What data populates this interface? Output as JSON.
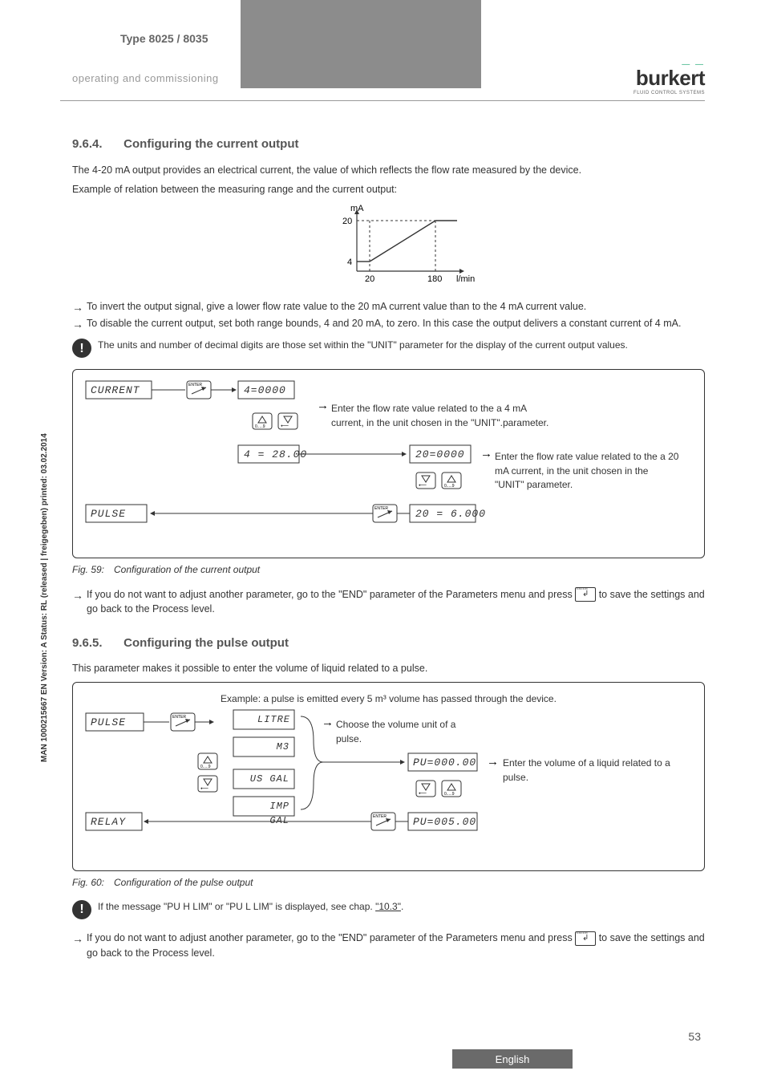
{
  "header": {
    "type_title": "Type 8025 / 8035",
    "subtitle": "operating and commissioning",
    "logo_name": "burkert",
    "logo_tag": "FLUID CONTROL SYSTEMS"
  },
  "sidebar_text": "MAN 1000215667 EN Version: A Status: RL (released | freigegeben) printed: 03.02.2014",
  "section964": {
    "num": "9.6.4.",
    "title": "Configuring the current output",
    "intro1": "The 4-20 mA output provides an electrical current, the value of which reflects the flow rate measured by the device.",
    "intro2": "Example of relation between the measuring range and the current output:",
    "chart": {
      "y_label": "mA",
      "y_ticks": [
        "20",
        "4"
      ],
      "x_ticks": [
        "20",
        "180"
      ],
      "x_label": "l/min"
    },
    "bullet1": "To invert the output signal, give a lower flow rate value to the 20 mA current value than to the 4 mA current value.",
    "bullet2": "To disable the current output, set both range bounds, 4 and 20 mA, to zero. In this case the output delivers a constant current of 4 mA.",
    "notice": "The units and number of decimal digits are those set within the \"UNIT\" parameter for the display of the current output values.",
    "flow": {
      "left_top": "CURRENT",
      "left_bottom": "PULSE",
      "n1": "4=0000",
      "n1b": "4 = 28.00",
      "hint1": "Enter the flow rate value related to the a 4 mA current, in the unit chosen in the \"UNIT\".parameter.",
      "n2": "20=0000",
      "n2b": "20 = 6.000",
      "hint2": "Enter the flow rate value related to the a 20 mA current, in the unit chosen in the \"UNIT\" parameter."
    },
    "fig_caption": "Fig. 59: Configuration of the current output",
    "after": "If you do not want to adjust another parameter, go to the \"END\" parameter of the Parameters menu and press ",
    "after2": " to save the settings and go back to the Process level."
  },
  "section965": {
    "num": "9.6.5.",
    "title": "Configuring the pulse output",
    "intro": "This parameter makes it possible to enter the volume of liquid related to a pulse.",
    "example": "Example: a pulse is emitted every 5 m³ volume has passed through the device.",
    "flow": {
      "left_top": "PULSE",
      "left_bottom": "RELAY",
      "units": [
        "LITRE",
        "M3",
        "US GAL",
        "IMP GAL"
      ],
      "hint1": "Choose the volume unit of a pulse.",
      "n1": "PU=000.00",
      "n1b": "PU=005.00",
      "hint2": "Enter the volume of a liquid related to a pulse."
    },
    "fig_caption": "Fig. 60: Configuration of the pulse output",
    "notice_pre": "If the message \"PU H LIM\" or \"PU L LIM\" is displayed, see chap. ",
    "notice_link": "\"10.3\"",
    "notice_post": ".",
    "after": "If you do not want to adjust another parameter, go to the \"END\" parameter of the Parameters menu and press ",
    "after2": " to save the settings and go back to the Process level."
  },
  "footer": {
    "page": "53",
    "lang": "English"
  },
  "chart_data": {
    "type": "line",
    "title": "Current output vs flow rate",
    "xlabel": "l/min",
    "ylabel": "mA",
    "x": [
      20,
      180
    ],
    "y": [
      4,
      20
    ],
    "xlim": [
      0,
      200
    ],
    "ylim": [
      0,
      22
    ]
  }
}
